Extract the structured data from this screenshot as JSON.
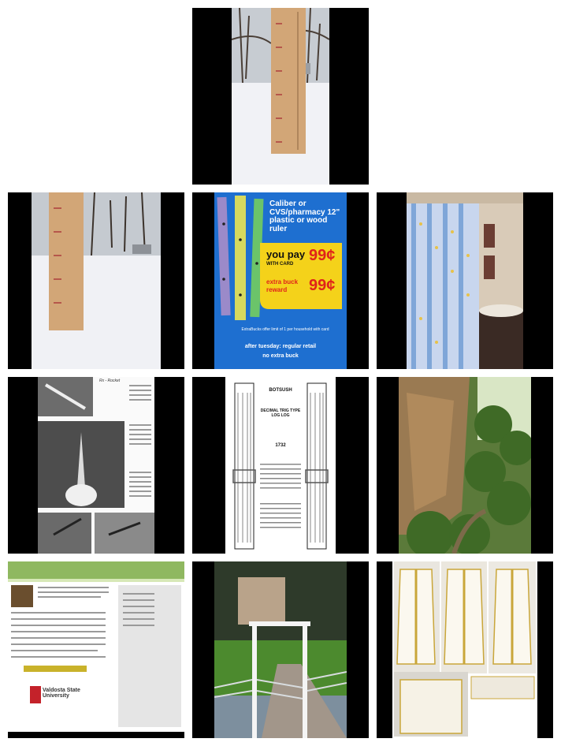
{
  "grid": {
    "thumbnails": [
      {
        "id": "snow-ruler-1",
        "subject": "yardstick in snow"
      },
      {
        "id": "snow-ruler-2",
        "subject": "yardstick in snow"
      },
      {
        "id": "ruler-ad",
        "subject": "ruler store ad"
      },
      {
        "id": "shower-curtain",
        "subject": "bathroom shower curtain"
      },
      {
        "id": "rocket-article",
        "subject": "rocket magazine page"
      },
      {
        "id": "slide-rule",
        "subject": "slide rule print"
      },
      {
        "id": "gorge",
        "subject": "rocky gorge with trees"
      },
      {
        "id": "webpage",
        "subject": "website screenshot"
      },
      {
        "id": "gate",
        "subject": "white gate on path"
      },
      {
        "id": "vestments",
        "subject": "white and gold vestments"
      }
    ]
  },
  "ad": {
    "headline": "Caliber or CVS/pharmacy 12\" plastic or wood ruler",
    "you_pay": "you pay",
    "with_card": "WITH CARD",
    "price1": "99¢",
    "extra_line1": "extra buck",
    "extra_line2": "reward",
    "price2": "99¢",
    "fine_print": "ExtraBucks offer limit of 1 per household with card",
    "footer_1": "after tuesday: regular retail",
    "footer_2": "no extra buck"
  },
  "rocket_page": {
    "header": "Rx - Rocket"
  },
  "slide_rule": {
    "brand": "BOTSUSH",
    "sub": "DECIMAL TRIG TYPE LOG LOG",
    "model": "1732"
  },
  "webpage": {
    "banner": "Valdosta State University"
  },
  "colors": {
    "ad_blue": "#1e6fd0",
    "ad_yellow": "#f4d21a",
    "ad_red": "#e0231a",
    "ruler_wood": "#d2a677"
  }
}
